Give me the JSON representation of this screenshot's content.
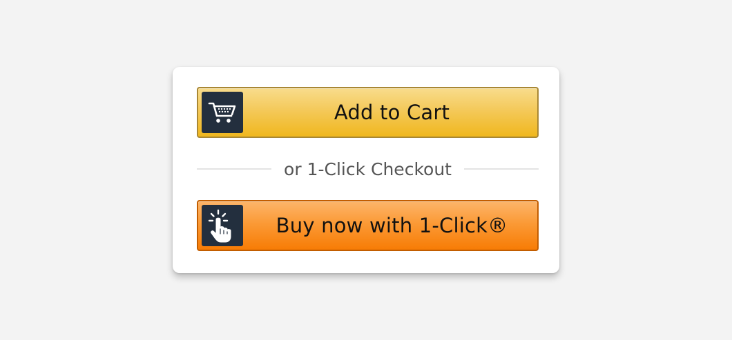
{
  "add_to_cart": {
    "label": "Add to Cart",
    "icon": "shopping-cart-icon"
  },
  "divider": {
    "text": "or 1-Click Checkout"
  },
  "buy_now": {
    "label": "Buy now with 1-Click®",
    "icon": "pointing-hand-click-icon"
  },
  "colors": {
    "page_background": "#f3f3f3",
    "card_background": "#ffffff",
    "add_to_cart_button": "#f0c14b",
    "add_to_cart_border": "#a88734",
    "buy_now_button": "#fa8900",
    "buy_now_border": "#c25d00",
    "icon_background": "#232f3e"
  }
}
